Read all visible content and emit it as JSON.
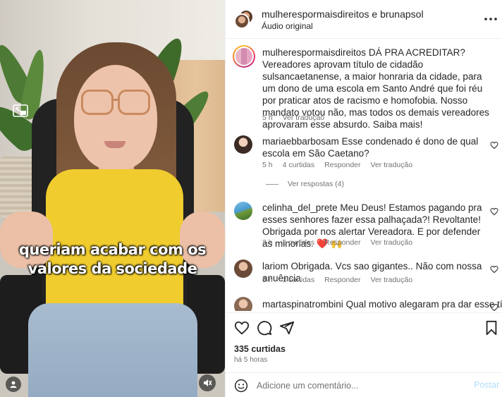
{
  "video": {
    "caption_line1": "queriam acabar com os",
    "caption_line2": "valores da sociedade",
    "icons": [
      "picture-in-picture-icon",
      "user-tag-icon",
      "mute-icon"
    ]
  },
  "header": {
    "username": "mulherespormaisdireitos e brunapsol",
    "audio": "Áudio original",
    "more_icon": "more-options-icon"
  },
  "caption_post": {
    "username": "mulherespormaisdireitos",
    "text": "DÁ PRA ACREDITAR? Vereadores aprovam título de cidadão sulsancaetanense, a maior honraria da cidade, para um dono de uma escola em Santo André que foi réu por praticar atos de racismo e homofobia. Nosso mandato votou não, mas todos os demais vereadores aprovaram esse absurdo. Saiba mais!",
    "time": "5 h",
    "translate": "Ver tradução"
  },
  "comments": [
    {
      "username": "mariaebbarbosam",
      "text": "Esse condenado é dono de qual escola em São Caetano?",
      "time": "5 h",
      "likes": "4 curtidas",
      "reply": "Responder",
      "translate": "Ver tradução",
      "view_replies": "Ver respostas (4)"
    },
    {
      "username": "celinha_del_prete",
      "text": "Meu Deus! Estamos pagando pra esses senhores fazer essa palhaçada?! Revoltante! Obrigada por nos alertar Vereadora. E por defender as minorias. ❤️ 🙌",
      "time": "3 h",
      "likes": "5 curtidas",
      "reply": "Responder",
      "translate": "Ver tradução"
    },
    {
      "username": "lariom",
      "text": "Obrigada. Vcs sao gigantes.. Não com nossa anuência",
      "time": "5 h",
      "likes": "3 curtidas",
      "reply": "Responder",
      "translate": "Ver tradução"
    },
    {
      "username": "martaspinatrombini",
      "text": "Qual motivo alegaram pra dar esse título?"
    }
  ],
  "actions": {
    "likes": "335 curtidas",
    "time_ago": "há 5 horas",
    "icons": [
      "heart-icon",
      "comment-icon",
      "share-icon",
      "bookmark-icon"
    ]
  },
  "composer": {
    "placeholder": "Adicione um comentário...",
    "post_label": "Postar"
  },
  "colors": {
    "link_blue_disabled": "#b2dffc",
    "secondary_text": "#737373",
    "primary_text": "#262626",
    "shirt_yellow": "#f0cc2e",
    "heart_red": "#e0245e"
  }
}
